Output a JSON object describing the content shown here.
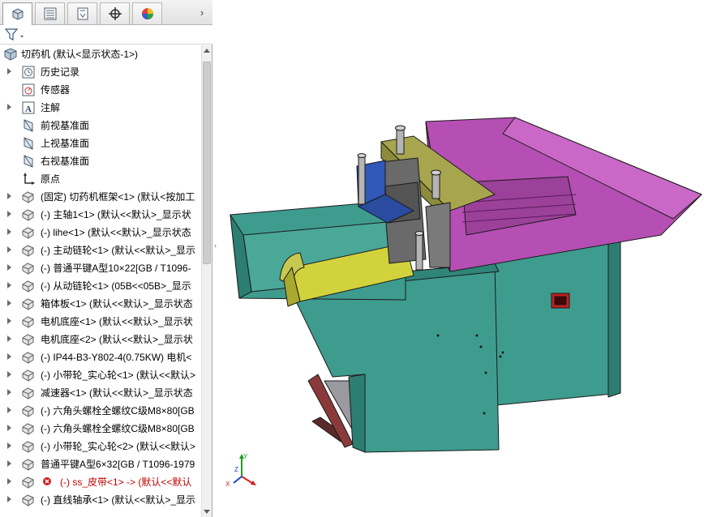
{
  "feature_tree": {
    "root": "切药机 (默认<显示状态-1>)",
    "items": [
      {
        "label": "历史记录",
        "icon": "history-icon",
        "expandable": true
      },
      {
        "label": "传感器",
        "icon": "sensor-icon",
        "expandable": false
      },
      {
        "label": "注解",
        "icon": "annotation-icon",
        "expandable": true
      },
      {
        "label": "前视基准面",
        "icon": "plane-icon",
        "expandable": false
      },
      {
        "label": "上视基准面",
        "icon": "plane-icon",
        "expandable": false
      },
      {
        "label": "右视基准面",
        "icon": "plane-icon",
        "expandable": false
      },
      {
        "label": "原点",
        "icon": "origin-icon",
        "expandable": false
      },
      {
        "label": "(固定) 切药机框架<1> (默认<按加工",
        "icon": "part-icon",
        "expandable": true
      },
      {
        "label": "(-) 主轴1<1> (默认<<默认>_显示状",
        "icon": "part-icon",
        "expandable": true
      },
      {
        "label": "(-) lihe<1> (默认<<默认>_显示状态",
        "icon": "part-icon",
        "expandable": true
      },
      {
        "label": "(-) 主动链轮<1> (默认<<默认>_显示",
        "icon": "part-icon",
        "expandable": true
      },
      {
        "label": "(-) 普通平键A型10×22[GB / T1096-",
        "icon": "part-icon",
        "expandable": true
      },
      {
        "label": "(-) 从动链轮<1> (05B<<05B>_显示",
        "icon": "part-icon",
        "expandable": true
      },
      {
        "label": "箱体板<1> (默认<<默认>_显示状态",
        "icon": "part-icon",
        "expandable": true
      },
      {
        "label": "电机底座<1> (默认<<默认>_显示状",
        "icon": "part-icon",
        "expandable": true
      },
      {
        "label": "电机底座<2> (默认<<默认>_显示状",
        "icon": "part-icon",
        "expandable": true
      },
      {
        "label": "(-) IP44-B3-Y802-4(0.75KW) 电机<",
        "icon": "part-icon",
        "expandable": true
      },
      {
        "label": "(-) 小带轮_实心轮<1> (默认<<默认>",
        "icon": "part-icon",
        "expandable": true
      },
      {
        "label": "减速器<1> (默认<<默认>_显示状态",
        "icon": "part-icon",
        "expandable": true
      },
      {
        "label": "(-) 六角头螺栓全螺纹C级M8×80[GB",
        "icon": "part-icon",
        "expandable": true
      },
      {
        "label": "(-) 六角头螺栓全螺纹C级M8×80[GB",
        "icon": "part-icon",
        "expandable": true
      },
      {
        "label": "(-) 小带轮_实心轮<2> (默认<<默认>",
        "icon": "part-icon",
        "expandable": true
      },
      {
        "label": "普通平键A型6×32[GB / T1096-1979",
        "icon": "part-icon",
        "expandable": true
      },
      {
        "label": "(-) ss_皮带<1> -> (默认<<默认",
        "icon": "part-icon",
        "expandable": true,
        "error": true
      },
      {
        "label": "(-) 直线轴承<1> (默认<<默认>_显示",
        "icon": "part-icon",
        "expandable": true
      }
    ]
  },
  "tabs": [
    {
      "name": "featuremanager-tab",
      "icon": "feature-tree-icon"
    },
    {
      "name": "propertymanager-tab",
      "icon": "property-list-icon"
    },
    {
      "name": "configurationmanager-tab",
      "icon": "configuration-icon"
    },
    {
      "name": "dimxpert-tab",
      "icon": "crosshair-icon"
    },
    {
      "name": "display-manager-tab",
      "icon": "appearance-icon"
    }
  ],
  "triad": {
    "x": "X",
    "y": "Y",
    "z": "Z"
  },
  "colors": {
    "teal": "#3d9e8e",
    "magenta": "#b64fb3",
    "olive": "#a7a64e",
    "yellow": "#d2d23c",
    "blue": "#3157b8",
    "error": "#c00000"
  }
}
